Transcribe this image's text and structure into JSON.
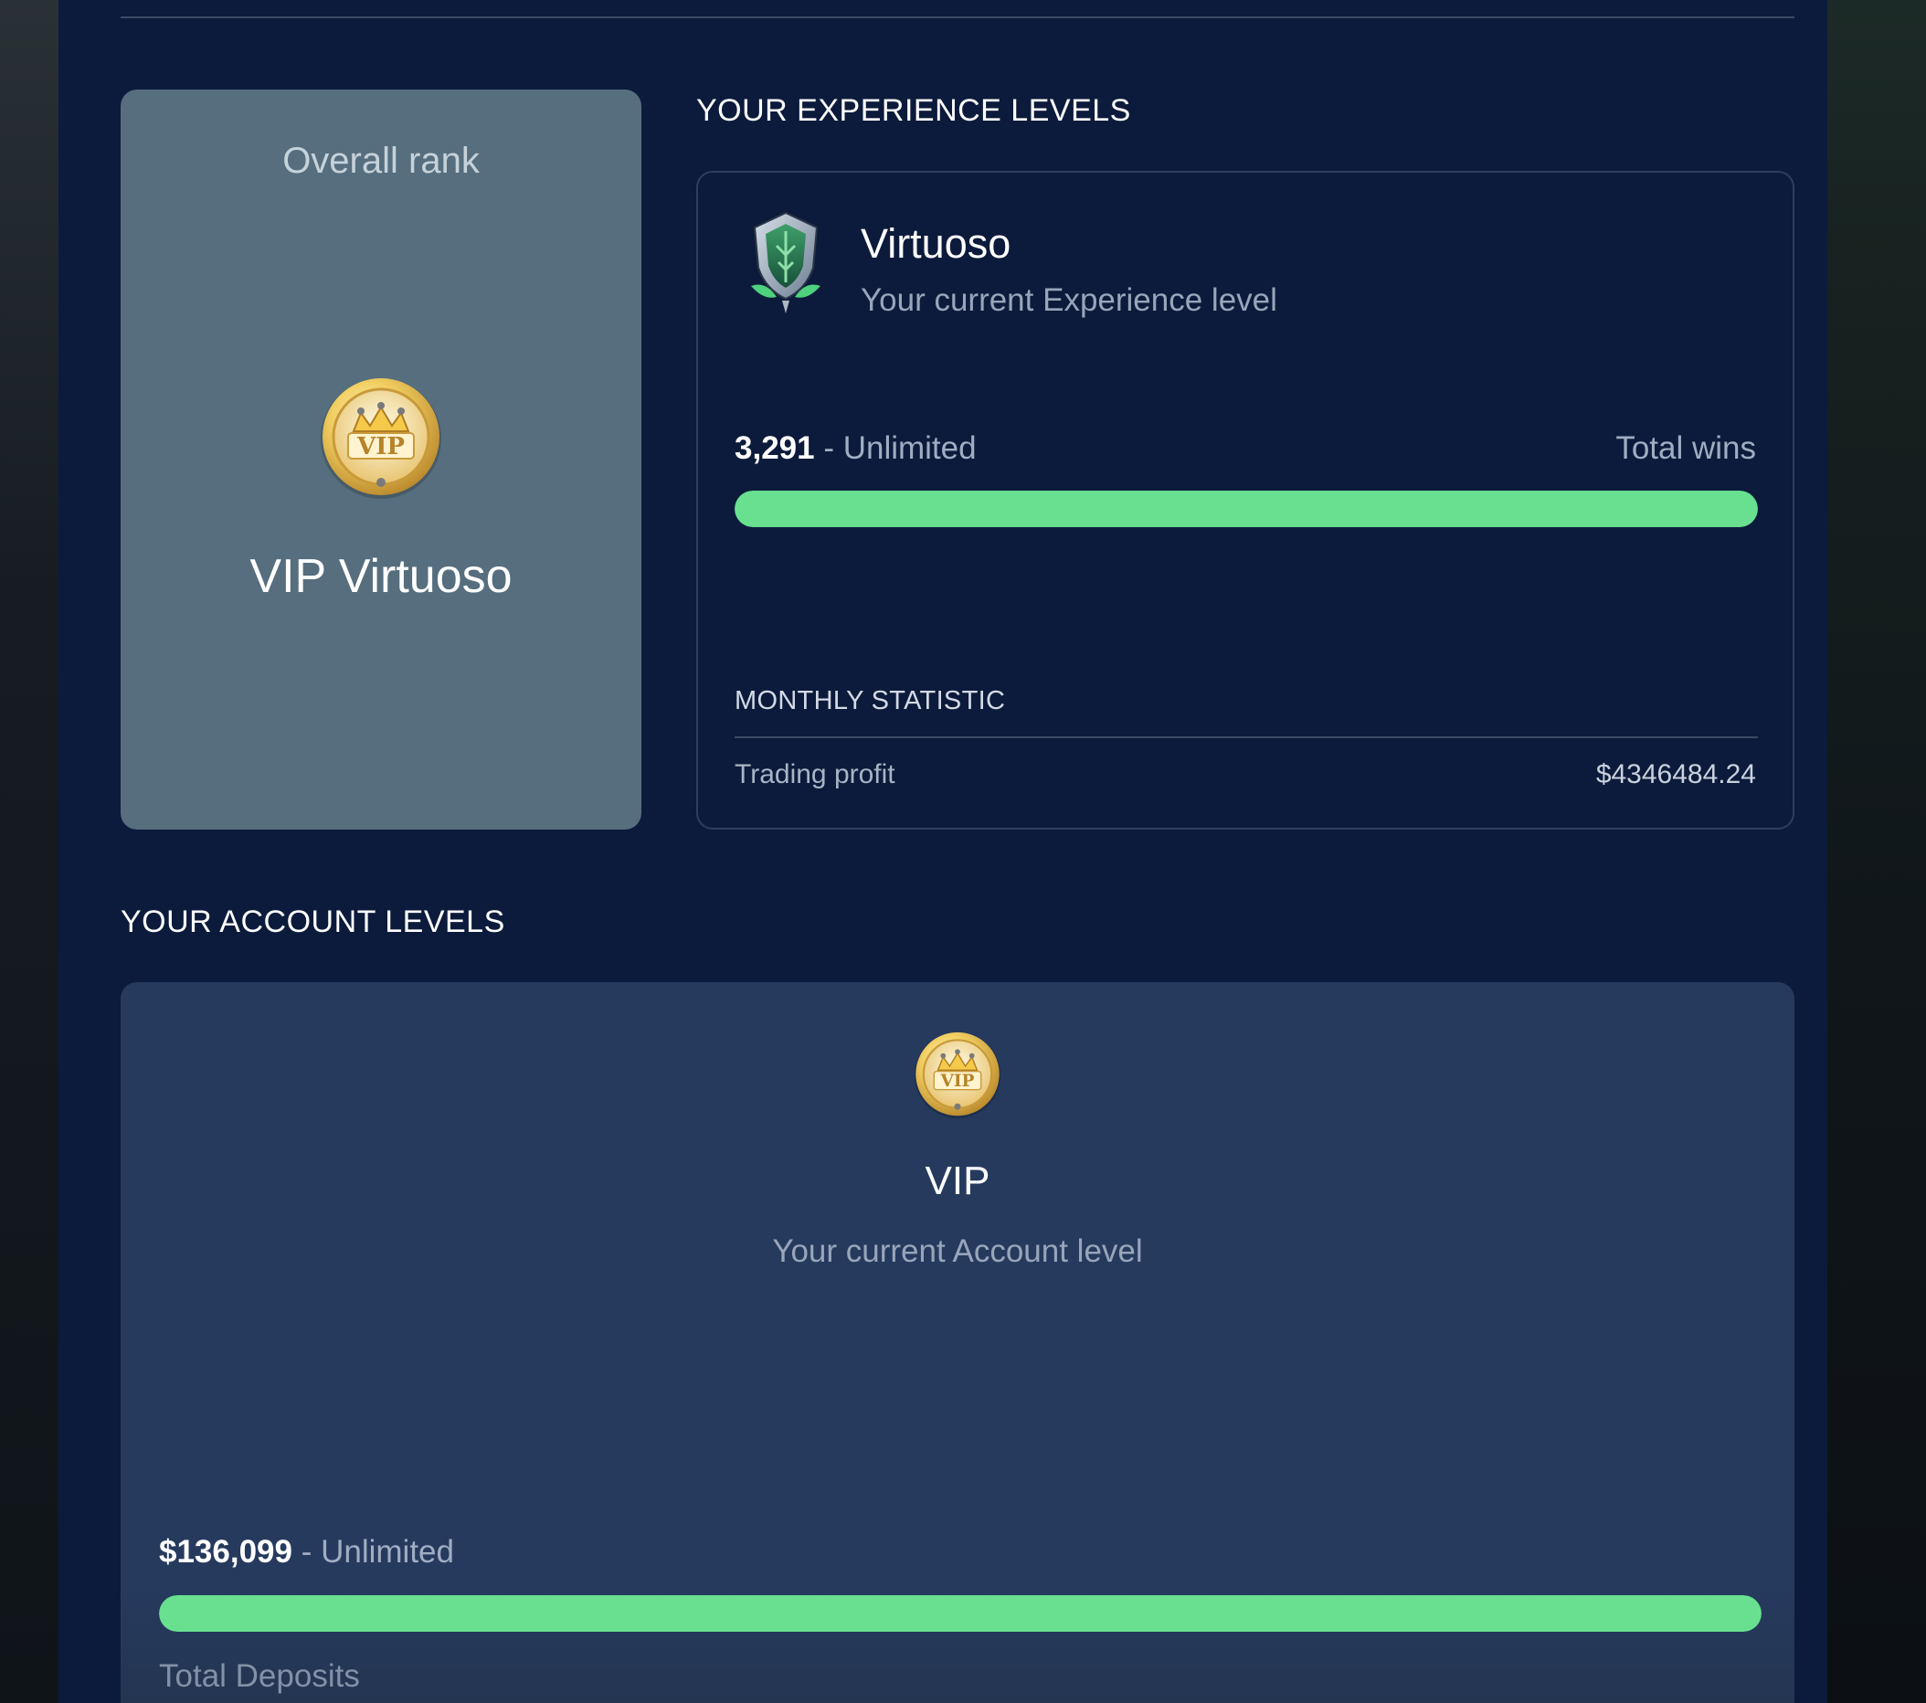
{
  "overall_rank": {
    "title": "Overall rank",
    "badge_icon": "vip-badge-icon",
    "name": "VIP Virtuoso"
  },
  "experience": {
    "heading": "YOUR EXPERIENCE LEVELS",
    "icon": "shield-badge-icon",
    "level_name": "Virtuoso",
    "level_subtitle": "Your current Experience level",
    "current_value": "3,291",
    "range_separator": " - ",
    "range_limit": "Unlimited",
    "metric_label": "Total wins",
    "progress_fraction": 1.0,
    "monthly": {
      "heading": "MONTHLY STATISTIC",
      "rows": [
        {
          "label": "Trading profit",
          "value": "$4346484.24"
        }
      ]
    }
  },
  "account": {
    "heading": "YOUR ACCOUNT LEVELS",
    "badge_icon": "vip-badge-icon",
    "level_name": "VIP",
    "level_subtitle": "Your current Account level",
    "current_value": "$136,099",
    "range_separator": " - ",
    "range_limit": "Unlimited",
    "metric_label": "Total Deposits",
    "progress_fraction": 1.0
  },
  "colors": {
    "background": "#0c1b3b",
    "rank_card": "#566e7e",
    "account_card": "#263a5e",
    "progress_fill": "#68e090"
  }
}
